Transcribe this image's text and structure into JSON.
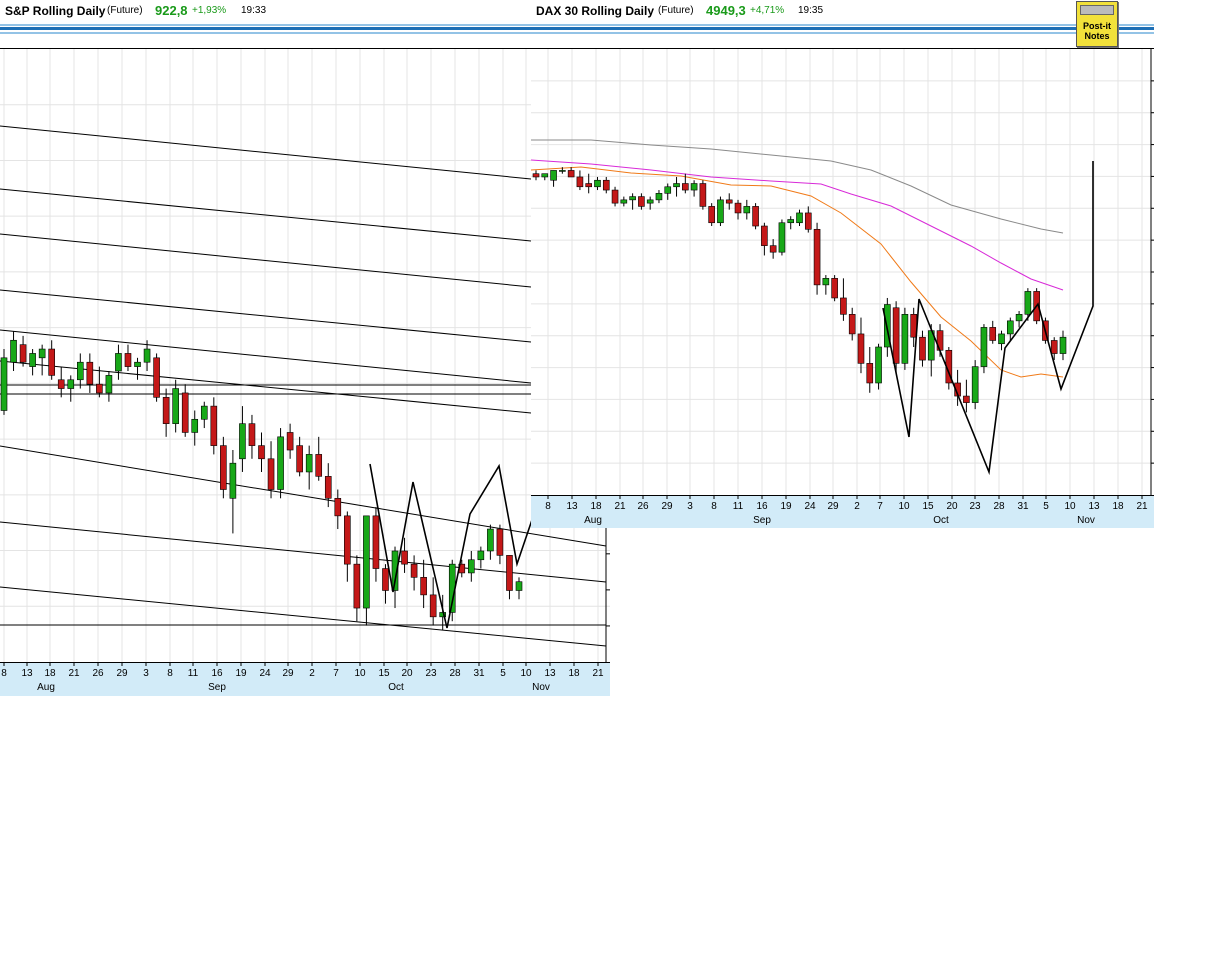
{
  "colors": {
    "up": "#18a818",
    "down": "#c41818",
    "grid": "#e4e4e4",
    "axis_bg": "#d2ebf8",
    "accent": "#1e6fb5"
  },
  "left_chart": {
    "title": "S&P Rolling Daily",
    "type_label": "(Future)",
    "price": "922,8",
    "change": "+1,93%",
    "time": "19:33",
    "x_ticks": [
      "8",
      "13",
      "18",
      "21",
      "26",
      "29",
      "3",
      "8",
      "11",
      "16",
      "19",
      "24",
      "29",
      "2",
      "7",
      "10",
      "15",
      "20",
      "23",
      "28",
      "31",
      "5",
      "10",
      "13",
      "18",
      "21"
    ],
    "months": [
      "Aug",
      "Sep",
      "Oct",
      "Nov"
    ]
  },
  "right_chart": {
    "title": "DAX 30  Rolling Daily",
    "type_label": "(Future)",
    "price": "4949,3",
    "change": "+4,71%",
    "time": "19:35",
    "x_ticks": [
      "8",
      "13",
      "18",
      "21",
      "26",
      "29",
      "3",
      "8",
      "11",
      "16",
      "19",
      "24",
      "29",
      "2",
      "7",
      "10",
      "15",
      "20",
      "23",
      "28",
      "31",
      "5",
      "10",
      "13",
      "18",
      "21"
    ],
    "months": [
      "Aug",
      "Sep",
      "Oct",
      "Nov"
    ]
  },
  "post_it": {
    "line1": "Post-it",
    "line2": "Notes"
  },
  "chart_data": [
    {
      "type": "candlestick",
      "title": "S&P Rolling Daily",
      "xlabel": "",
      "ylabel": "",
      "y_axis_labels": false,
      "ylim": [
        0,
        100
      ],
      "candles": [
        {
          "o": 50,
          "h": 64,
          "l": 49,
          "c": 62
        },
        {
          "o": 61,
          "h": 68,
          "l": 59,
          "c": 66
        },
        {
          "o": 65,
          "h": 67,
          "l": 60,
          "c": 61
        },
        {
          "o": 60,
          "h": 64,
          "l": 58,
          "c": 63
        },
        {
          "o": 62,
          "h": 65,
          "l": 58,
          "c": 64
        },
        {
          "o": 64,
          "h": 66,
          "l": 57,
          "c": 58
        },
        {
          "o": 57,
          "h": 60,
          "l": 53,
          "c": 55
        },
        {
          "o": 55,
          "h": 58,
          "l": 52,
          "c": 57
        },
        {
          "o": 57,
          "h": 63,
          "l": 55,
          "c": 61
        },
        {
          "o": 61,
          "h": 63,
          "l": 54,
          "c": 56
        },
        {
          "o": 56,
          "h": 60,
          "l": 53,
          "c": 54
        },
        {
          "o": 54,
          "h": 59,
          "l": 52,
          "c": 58
        },
        {
          "o": 59,
          "h": 65,
          "l": 57,
          "c": 63
        },
        {
          "o": 63,
          "h": 65,
          "l": 59,
          "c": 60
        },
        {
          "o": 60,
          "h": 62,
          "l": 57,
          "c": 61
        },
        {
          "o": 61,
          "h": 66,
          "l": 59,
          "c": 64
        },
        {
          "o": 62,
          "h": 63,
          "l": 52,
          "c": 53
        },
        {
          "o": 53,
          "h": 55,
          "l": 44,
          "c": 47
        },
        {
          "o": 47,
          "h": 57,
          "l": 45,
          "c": 55
        },
        {
          "o": 54,
          "h": 56,
          "l": 44,
          "c": 45
        },
        {
          "o": 45,
          "h": 50,
          "l": 42,
          "c": 48
        },
        {
          "o": 48,
          "h": 52,
          "l": 46,
          "c": 51
        },
        {
          "o": 51,
          "h": 53,
          "l": 40,
          "c": 42
        },
        {
          "o": 42,
          "h": 44,
          "l": 30,
          "c": 32
        },
        {
          "o": 30,
          "h": 41,
          "l": 22,
          "c": 38
        },
        {
          "o": 39,
          "h": 51,
          "l": 36,
          "c": 47
        },
        {
          "o": 47,
          "h": 49,
          "l": 39,
          "c": 42
        },
        {
          "o": 42,
          "h": 45,
          "l": 36,
          "c": 39
        },
        {
          "o": 39,
          "h": 43,
          "l": 30,
          "c": 32
        },
        {
          "o": 32,
          "h": 46,
          "l": 30,
          "c": 44
        },
        {
          "o": 45,
          "h": 47,
          "l": 39,
          "c": 41
        },
        {
          "o": 42,
          "h": 44,
          "l": 35,
          "c": 36
        },
        {
          "o": 36,
          "h": 42,
          "l": 32,
          "c": 40
        },
        {
          "o": 40,
          "h": 44,
          "l": 34,
          "c": 35
        },
        {
          "o": 35,
          "h": 38,
          "l": 28,
          "c": 30
        },
        {
          "o": 30,
          "h": 32,
          "l": 23,
          "c": 26
        },
        {
          "o": 26,
          "h": 27,
          "l": 11,
          "c": 15
        },
        {
          "o": 15,
          "h": 17,
          "l": 2,
          "c": 5
        },
        {
          "o": 5,
          "h": 21,
          "l": 1,
          "c": 26
        },
        {
          "o": 26,
          "h": 28,
          "l": 11,
          "c": 14
        },
        {
          "o": 14,
          "h": 15,
          "l": 6,
          "c": 9
        },
        {
          "o": 9,
          "h": 19,
          "l": 5,
          "c": 18
        },
        {
          "o": 18,
          "h": 21,
          "l": 13,
          "c": 15
        },
        {
          "o": 15,
          "h": 17,
          "l": 9,
          "c": 12
        },
        {
          "o": 12,
          "h": 16,
          "l": 5,
          "c": 8
        },
        {
          "o": 8,
          "h": 12,
          "l": 1,
          "c": 3
        },
        {
          "o": 3,
          "h": 8,
          "l": 0,
          "c": 4
        },
        {
          "o": 4,
          "h": 16,
          "l": 2,
          "c": 15
        },
        {
          "o": 15,
          "h": 16,
          "l": 12,
          "c": 13
        },
        {
          "o": 13,
          "h": 18,
          "l": 11,
          "c": 16
        },
        {
          "o": 16,
          "h": 19,
          "l": 14,
          "c": 18
        },
        {
          "o": 18,
          "h": 24,
          "l": 16,
          "c": 23
        },
        {
          "o": 23,
          "h": 24,
          "l": 15,
          "c": 17
        },
        {
          "o": 17,
          "h": 17,
          "l": 7,
          "c": 9
        },
        {
          "o": 9,
          "h": 12,
          "l": 7,
          "c": 11
        }
      ]
    },
    {
      "type": "candlestick",
      "title": "DAX 30  Rolling Daily",
      "xlabel": "",
      "ylabel": "",
      "y_axis_labels": false,
      "ylim": [
        0,
        100
      ],
      "candles": [
        {
          "o": 90,
          "h": 91,
          "l": 88,
          "c": 89
        },
        {
          "o": 89,
          "h": 90,
          "l": 88,
          "c": 90
        },
        {
          "o": 88,
          "h": 91,
          "l": 86,
          "c": 91
        },
        {
          "o": 91,
          "h": 92,
          "l": 90,
          "c": 91
        },
        {
          "o": 91,
          "h": 92,
          "l": 89,
          "c": 89
        },
        {
          "o": 89,
          "h": 91,
          "l": 85,
          "c": 86
        },
        {
          "o": 87,
          "h": 90,
          "l": 84,
          "c": 86
        },
        {
          "o": 86,
          "h": 89,
          "l": 85,
          "c": 88
        },
        {
          "o": 88,
          "h": 89,
          "l": 84,
          "c": 85
        },
        {
          "o": 85,
          "h": 86,
          "l": 80,
          "c": 81
        },
        {
          "o": 81,
          "h": 83,
          "l": 80,
          "c": 82
        },
        {
          "o": 82,
          "h": 84,
          "l": 79,
          "c": 83
        },
        {
          "o": 83,
          "h": 84,
          "l": 79,
          "c": 80
        },
        {
          "o": 81,
          "h": 83,
          "l": 79,
          "c": 82
        },
        {
          "o": 82,
          "h": 85,
          "l": 81,
          "c": 84
        },
        {
          "o": 84,
          "h": 87,
          "l": 82,
          "c": 86
        },
        {
          "o": 86,
          "h": 89,
          "l": 83,
          "c": 87
        },
        {
          "o": 87,
          "h": 90,
          "l": 84,
          "c": 85
        },
        {
          "o": 85,
          "h": 88,
          "l": 83,
          "c": 87
        },
        {
          "o": 87,
          "h": 88,
          "l": 79,
          "c": 80
        },
        {
          "o": 80,
          "h": 81,
          "l": 74,
          "c": 75
        },
        {
          "o": 75,
          "h": 83,
          "l": 74,
          "c": 82
        },
        {
          "o": 82,
          "h": 84,
          "l": 79,
          "c": 81
        },
        {
          "o": 81,
          "h": 82,
          "l": 76,
          "c": 78
        },
        {
          "o": 78,
          "h": 82,
          "l": 76,
          "c": 80
        },
        {
          "o": 80,
          "h": 81,
          "l": 73,
          "c": 74
        },
        {
          "o": 74,
          "h": 75,
          "l": 65,
          "c": 68
        },
        {
          "o": 68,
          "h": 70,
          "l": 64,
          "c": 66
        },
        {
          "o": 66,
          "h": 76,
          "l": 65,
          "c": 75
        },
        {
          "o": 75,
          "h": 77,
          "l": 73,
          "c": 76
        },
        {
          "o": 75,
          "h": 79,
          "l": 74,
          "c": 78
        },
        {
          "o": 78,
          "h": 80,
          "l": 72,
          "c": 73
        },
        {
          "o": 73,
          "h": 75,
          "l": 53,
          "c": 56
        },
        {
          "o": 56,
          "h": 59,
          "l": 53,
          "c": 58
        },
        {
          "o": 58,
          "h": 59,
          "l": 51,
          "c": 52
        },
        {
          "o": 52,
          "h": 58,
          "l": 45,
          "c": 47
        },
        {
          "o": 47,
          "h": 49,
          "l": 39,
          "c": 41
        },
        {
          "o": 41,
          "h": 46,
          "l": 29,
          "c": 32
        },
        {
          "o": 32,
          "h": 37,
          "l": 23,
          "c": 26
        },
        {
          "o": 26,
          "h": 38,
          "l": 24,
          "c": 37
        },
        {
          "o": 37,
          "h": 52,
          "l": 34,
          "c": 50
        },
        {
          "o": 49,
          "h": 51,
          "l": 29,
          "c": 32
        },
        {
          "o": 32,
          "h": 49,
          "l": 30,
          "c": 47
        },
        {
          "o": 47,
          "h": 49,
          "l": 37,
          "c": 40
        },
        {
          "o": 40,
          "h": 42,
          "l": 31,
          "c": 33
        },
        {
          "o": 33,
          "h": 44,
          "l": 28,
          "c": 42
        },
        {
          "o": 42,
          "h": 44,
          "l": 34,
          "c": 36
        },
        {
          "o": 36,
          "h": 37,
          "l": 24,
          "c": 26
        },
        {
          "o": 26,
          "h": 30,
          "l": 19,
          "c": 22
        },
        {
          "o": 22,
          "h": 27,
          "l": 17,
          "c": 20
        },
        {
          "o": 20,
          "h": 33,
          "l": 18,
          "c": 31
        },
        {
          "o": 31,
          "h": 44,
          "l": 29,
          "c": 43
        },
        {
          "o": 43,
          "h": 45,
          "l": 38,
          "c": 39
        },
        {
          "o": 38,
          "h": 42,
          "l": 36,
          "c": 41
        },
        {
          "o": 41,
          "h": 46,
          "l": 39,
          "c": 45
        },
        {
          "o": 45,
          "h": 48,
          "l": 43,
          "c": 47
        },
        {
          "o": 47,
          "h": 55,
          "l": 45,
          "c": 54
        },
        {
          "o": 54,
          "h": 55,
          "l": 44,
          "c": 45
        },
        {
          "o": 45,
          "h": 46,
          "l": 38,
          "c": 39
        },
        {
          "o": 39,
          "h": 40,
          "l": 33,
          "c": 35
        },
        {
          "o": 35,
          "h": 42,
          "l": 33,
          "c": 40
        }
      ]
    }
  ]
}
